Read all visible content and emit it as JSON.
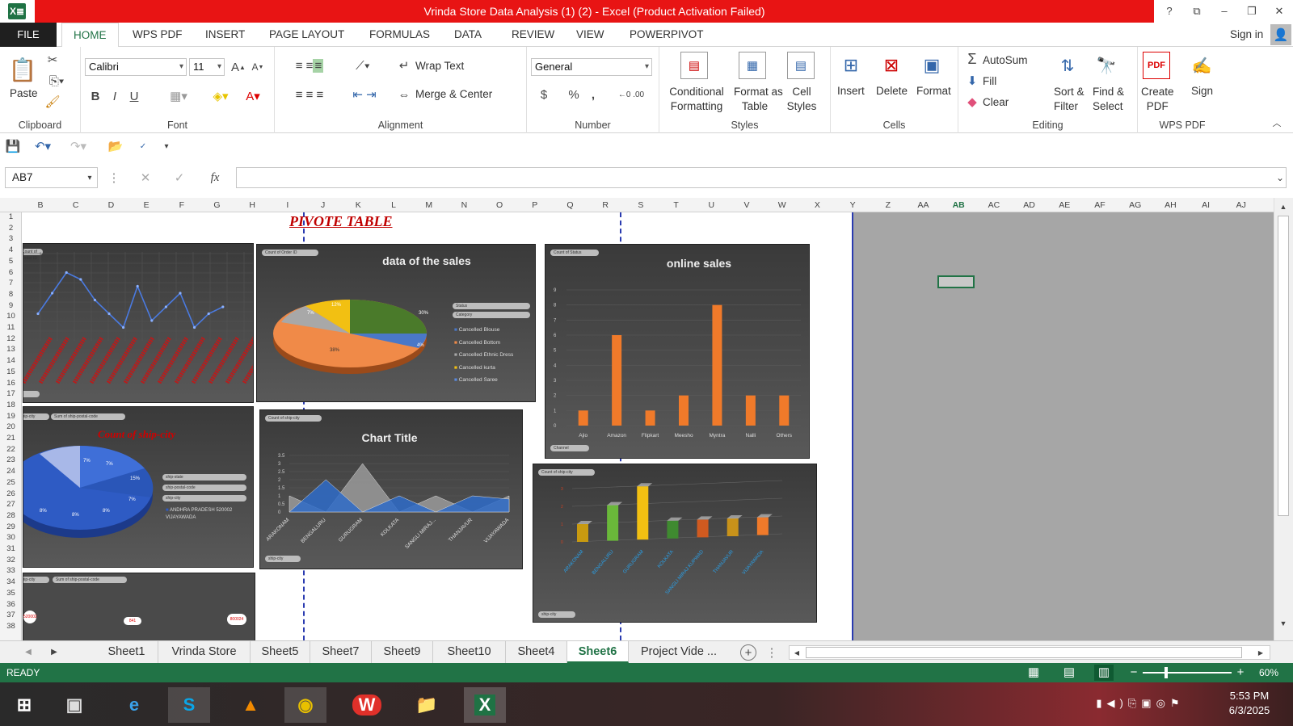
{
  "window": {
    "title": "Vrinda Store Data Analysis (1) (2) -  Excel (Product Activation Failed)",
    "app_icon": "X≣",
    "controls": [
      "?",
      "⧉",
      "–",
      "❐",
      "✕"
    ]
  },
  "menu": {
    "file": "FILE",
    "tabs": [
      "HOME",
      "WPS PDF",
      "INSERT",
      "PAGE LAYOUT",
      "FORMULAS",
      "DATA",
      "REVIEW",
      "VIEW",
      "POWERPIVOT"
    ],
    "active": "HOME",
    "signin": "Sign in"
  },
  "ribbon": {
    "clipboard": {
      "label": "Clipboard",
      "paste": "Paste"
    },
    "font": {
      "label": "Font",
      "name": "Calibri",
      "size": "11",
      "bold": "B",
      "italic": "I",
      "underline": "U"
    },
    "alignment": {
      "label": "Alignment",
      "wrap": "Wrap Text",
      "merge": "Merge & Center"
    },
    "number": {
      "label": "Number",
      "format": "General",
      "currency": "$",
      "percent": "%",
      "comma": ","
    },
    "styles": {
      "label": "Styles",
      "cond1": "Conditional",
      "cond2": "Formatting",
      "fat1": "Format as",
      "fat2": "Table",
      "cell1": "Cell",
      "cell2": "Styles"
    },
    "cells": {
      "label": "Cells",
      "insert": "Insert",
      "delete": "Delete",
      "format": "Format"
    },
    "editing": {
      "label": "Editing",
      "autosum": "AutoSum",
      "fill": "Fill",
      "clear": "Clear",
      "sort1": "Sort &",
      "sort2": "Filter",
      "find1": "Find &",
      "find2": "Select"
    },
    "wps": {
      "label": "WPS PDF",
      "create1": "Create",
      "create2": "PDF",
      "sign": "Sign"
    }
  },
  "formula_bar": {
    "namebox": "AB7",
    "value": "",
    "fx": "fx"
  },
  "columns": [
    "B",
    "C",
    "D",
    "E",
    "F",
    "G",
    "H",
    "I",
    "J",
    "K",
    "L",
    "M",
    "N",
    "O",
    "P",
    "Q",
    "R",
    "S",
    "T",
    "U",
    "V",
    "W",
    "X",
    "Y",
    "Z",
    "AA",
    "AB",
    "AC",
    "AD",
    "AE",
    "AF",
    "AG",
    "AH",
    "AI",
    "AJ"
  ],
  "rows": [
    "1",
    "2",
    "3",
    "4",
    "5",
    "6",
    "7",
    "8",
    "9",
    "10",
    "11",
    "12",
    "13",
    "14",
    "15",
    "16",
    "17",
    "18",
    "19",
    "20",
    "21",
    "22",
    "23",
    "24",
    "25",
    "26",
    "27",
    "28",
    "29",
    "30",
    "31",
    "32",
    "33",
    "34",
    "35",
    "36",
    "37",
    "38"
  ],
  "sheet_title": "PIVOTE TABLE",
  "chart_data": [
    {
      "type": "line",
      "title": "",
      "pill": "Count of Order ID",
      "values": [
        3,
        6,
        9,
        8,
        5,
        3,
        1,
        7,
        2,
        4,
        6,
        1,
        3,
        4
      ]
    },
    {
      "type": "pie",
      "title": "data of the sales",
      "pill": "Count of Order ID",
      "filters": [
        "Status",
        "Category"
      ],
      "legend": [
        "Cancelled Blouse",
        "Cancelled Bottom",
        "Cancelled Ethnic Dress",
        "Cancelled kurta",
        "Cancelled Saree"
      ],
      "labels": [
        "38%",
        "30%",
        "7%",
        "4%",
        "12%"
      ]
    },
    {
      "type": "bar",
      "title": "online sales",
      "pill": "Count of Status",
      "filter": "Channel",
      "categories": [
        "Ajio",
        "Amazon",
        "Flipkart",
        "Meesho",
        "Myntra",
        "Nalli",
        "Others"
      ],
      "values": [
        1,
        6,
        1,
        2,
        8,
        2,
        2
      ],
      "ylim": [
        0,
        9
      ],
      "ticks": [
        "0",
        "1",
        "2",
        "3",
        "4",
        "5",
        "6",
        "7",
        "8",
        "9"
      ]
    },
    {
      "type": "pie",
      "title": "Count of ship-city",
      "pills": [
        "ship-city",
        "Sum of ship-postal-code"
      ],
      "filters": [
        "ship-state",
        "ship-postal-code",
        "ship-city"
      ],
      "legend": [
        "ANDHRA PRADESH  520002",
        "VIJAYAWADA"
      ],
      "labels": [
        "7%",
        "7%",
        "15%",
        "7%",
        "8%",
        "8%",
        "8%"
      ]
    },
    {
      "type": "area",
      "title": "Chart Title",
      "pill": "Count of ship-city",
      "filter": "ship-city",
      "categories": [
        "ARAKONAM",
        "BENGALURU",
        "GURUGRAM",
        "KOLKATA",
        "SANGLI MIRAJ...",
        "THANJAVUR",
        "VIJAYAWADA"
      ],
      "series": [
        {
          "values": [
            1,
            0,
            3,
            0,
            1,
            0,
            1
          ]
        },
        {
          "values": [
            0,
            2,
            0,
            1,
            0,
            1,
            0.8
          ]
        }
      ],
      "ticks": [
        "0",
        "0.5",
        "1",
        "1.5",
        "2",
        "2.5",
        "3",
        "3.5"
      ]
    },
    {
      "type": "bar",
      "title": "",
      "pill": "Count of ship-city",
      "filter": "ship-city",
      "categories": [
        "ARAKONAM",
        "BENGALURU",
        "GURUGRAM",
        "KOLKATA",
        "SANGLI MIRAJ KUPWAD",
        "THANJAVUR",
        "VIJAYAWADA"
      ],
      "values": [
        1,
        2,
        3,
        1,
        1,
        1,
        1
      ],
      "ticks": [
        "0",
        "1",
        "2",
        "3"
      ]
    },
    {
      "type": "map",
      "pills": [
        "ship-city",
        "Sum of ship-postal-code"
      ],
      "labels": [
        "520002",
        "841",
        "800024"
      ]
    }
  ],
  "sheet_tabs": [
    "Sheet1",
    "Vrinda Store",
    "Sheet5",
    "Sheet7",
    "Sheet9",
    "Sheet10",
    "Sheet4",
    "Sheet6",
    "Project Vide ..."
  ],
  "active_sheet": "Sheet6",
  "status": {
    "ready": "READY",
    "zoom": "60%"
  },
  "taskbar": {
    "time": "5:53 PM",
    "date": "6/3/2025"
  }
}
